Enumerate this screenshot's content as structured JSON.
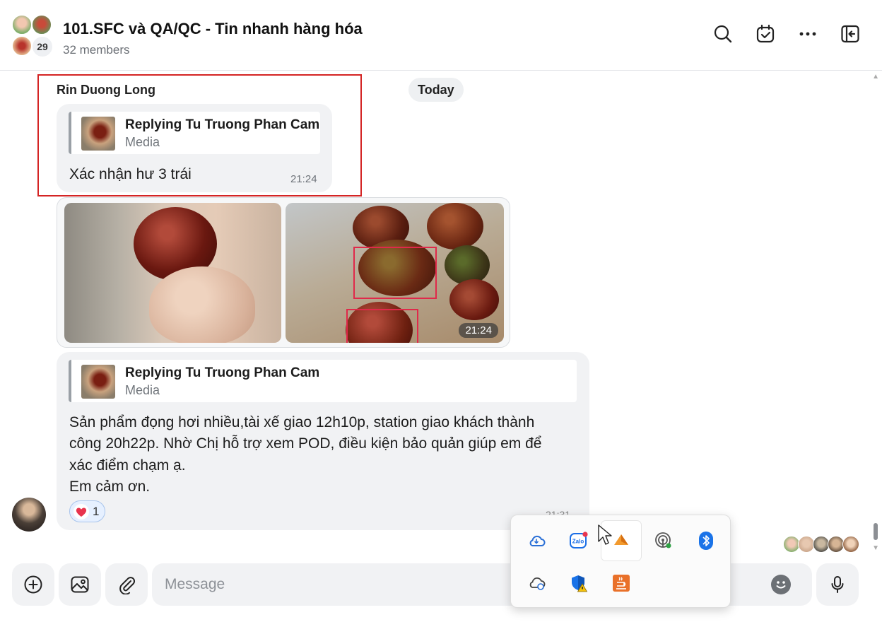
{
  "header": {
    "title": "101.SFC và QA/QC - Tin nhanh hàng hóa",
    "members": "32 members",
    "avatar_count": "29"
  },
  "date_separator": "Today",
  "messages": [
    {
      "sender": "Rin Duong Long",
      "reply_title": "Replying Tu Truong Phan Cam",
      "reply_sub": "Media",
      "text": "Xác nhận hư 3 trái",
      "time": "21:24"
    },
    {
      "media_time": "21:24"
    },
    {
      "reply_title": "Replying Tu Truong Phan Cam",
      "reply_sub": "Media",
      "lines": [
        "Sản phẩm đọng hơi nhiều,tài xế giao 12h10p, station giao khách thành",
        "công 20h22p. Nhờ Chị hỗ trợ xem POD, điều kiện bảo quản giúp em để",
        "xác điểm chạm ạ.",
        "Em cảm ơn."
      ],
      "reaction_count": "1",
      "time": "21:31"
    }
  ],
  "input": {
    "placeholder": "Message"
  },
  "tray_icons": [
    "onedrive-icon",
    "zalo-icon",
    "app-orange-icon",
    "wifi-icon",
    "bluetooth-icon",
    "cloud-sync-icon",
    "security-warning-icon",
    "java-icon"
  ],
  "colors": {
    "highlight": "#d42424",
    "bubble": "#f1f2f4",
    "reaction_heart": "#e8344e"
  }
}
